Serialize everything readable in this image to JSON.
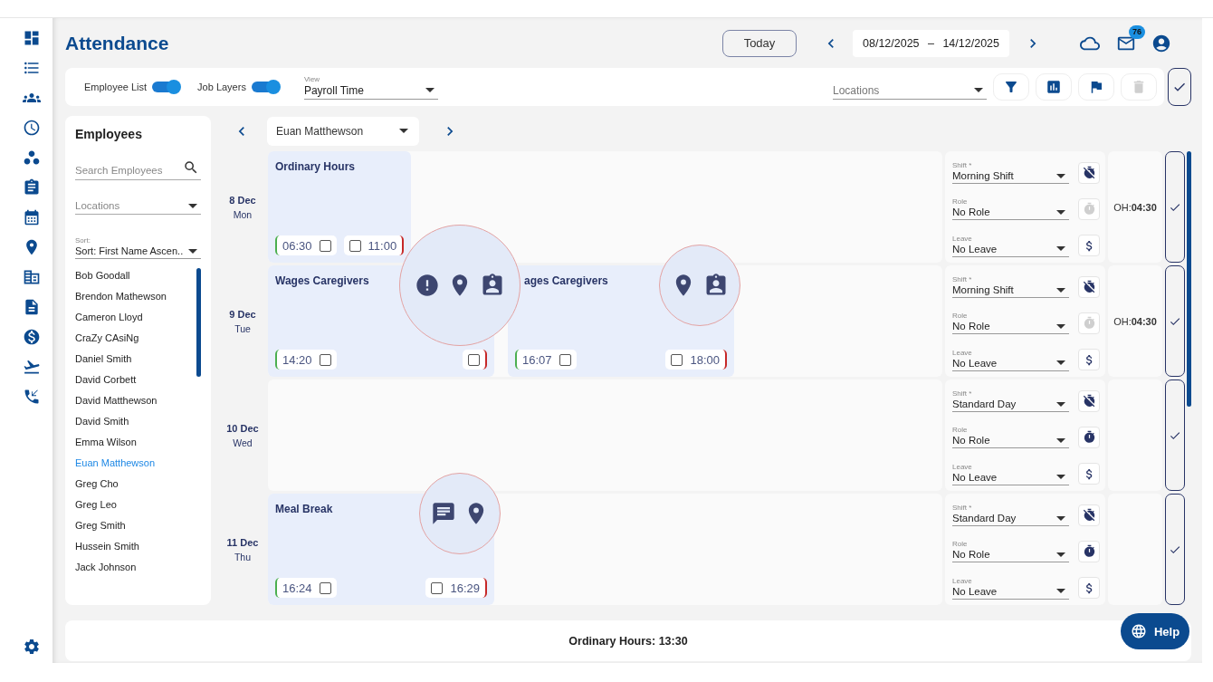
{
  "header": {
    "title": "Attendance",
    "today": "Today",
    "date_from": "08/12/2025",
    "date_sep": "–",
    "date_to": "14/12/2025",
    "mail_badge": "76"
  },
  "toolbar": {
    "toggles": [
      {
        "label": "Employee List",
        "on": true
      },
      {
        "label": "Job Layers",
        "on": true
      }
    ],
    "view": {
      "label": "View",
      "value": "Payroll Time"
    },
    "locations": {
      "placeholder": "Locations"
    },
    "actions": [
      {
        "kind": "filter",
        "disabled": false
      },
      {
        "kind": "chart",
        "disabled": false
      },
      {
        "kind": "flag",
        "disabled": false
      },
      {
        "kind": "delete",
        "disabled": true
      }
    ]
  },
  "employees": {
    "title": "Employees",
    "search": {
      "placeholder": "Search Employees"
    },
    "locations": {
      "placeholder": "Locations"
    },
    "sort": {
      "label": "Sort:",
      "value": "Sort: First Name Ascen.."
    },
    "items": [
      {
        "name": "Bob Goodall",
        "selected": false
      },
      {
        "name": "Brendon Mathewson",
        "selected": false
      },
      {
        "name": "Cameron Lloyd",
        "selected": false
      },
      {
        "name": "CraZy CAsiNg",
        "selected": false
      },
      {
        "name": "Daniel Smith",
        "selected": false
      },
      {
        "name": "David Corbett",
        "selected": false
      },
      {
        "name": "David Matthewson",
        "selected": false
      },
      {
        "name": "David Smith",
        "selected": false
      },
      {
        "name": "Emma Wilson",
        "selected": false
      },
      {
        "name": "Euan Matthewson",
        "selected": true
      },
      {
        "name": "Greg Cho",
        "selected": false
      },
      {
        "name": "Greg Leo",
        "selected": false
      },
      {
        "name": "Greg Smith",
        "selected": false
      },
      {
        "name": "Hussein Smith",
        "selected": false
      },
      {
        "name": "Jack Johnson",
        "selected": false
      }
    ]
  },
  "schedule": {
    "employee": "Euan Matthewson",
    "days": [
      {
        "date": "8 Dec",
        "weekday": "Mon",
        "blocks": [
          {
            "title": "Ordinary Hours",
            "start": {
              "time": "06:30",
              "checked": false
            },
            "end": {
              "time": "11:00",
              "checked": false
            }
          }
        ],
        "fields": [
          {
            "label": "Shift *",
            "value": "Morning Shift",
            "kind": "timer-off",
            "disabled": false
          },
          {
            "label": "Role",
            "value": "No Role",
            "kind": "timer",
            "disabled": true
          },
          {
            "label": "Leave",
            "value": "No Leave",
            "kind": "dollar",
            "disabled": false
          }
        ],
        "hours": "OH:**04:30**"
      },
      {
        "date": "9 Dec",
        "weekday": "Tue",
        "blocks": [
          {
            "title": "Wages Caregivers",
            "start": {
              "time": "14:20",
              "checked": false
            },
            "end": {
              "checked": false
            },
            "indicators": [
              {
                "kind": "alert"
              },
              {
                "kind": "location"
              },
              {
                "kind": "contact"
              }
            ]
          },
          {
            "title": "ages Caregivers",
            "start": {
              "time": "16:07",
              "checked": false
            },
            "end": {
              "time": "18:00",
              "checked": false
            },
            "indicators": [
              {
                "kind": "location"
              },
              {
                "kind": "contact"
              }
            ]
          }
        ],
        "fields": [
          {
            "label": "Shift *",
            "value": "Morning Shift",
            "kind": "timer-off",
            "disabled": false
          },
          {
            "label": "Role",
            "value": "No Role",
            "kind": "timer",
            "disabled": true
          },
          {
            "label": "Leave",
            "value": "No Leave",
            "kind": "dollar",
            "disabled": false
          }
        ],
        "hours": "OH:**04:30**"
      },
      {
        "date": "10 Dec",
        "weekday": "Wed",
        "fields": [
          {
            "label": "Shift *",
            "value": "Standard Day",
            "kind": "timer-off",
            "disabled": false
          },
          {
            "label": "Role",
            "value": "No Role",
            "kind": "timer",
            "disabled": false
          },
          {
            "label": "Leave",
            "value": "No Leave",
            "kind": "dollar",
            "disabled": false
          }
        ]
      },
      {
        "date": "11 Dec",
        "weekday": "Thu",
        "blocks": [
          {
            "title": "Meal Break",
            "start": {
              "time": "16:24",
              "checked": false
            },
            "end": {
              "time": "16:29",
              "checked": false
            },
            "indicators": [
              {
                "kind": "comment"
              },
              {
                "kind": "location"
              }
            ]
          }
        ],
        "fields": [
          {
            "label": "Shift *",
            "value": "Standard Day",
            "kind": "timer-off",
            "disabled": false
          },
          {
            "label": "Role",
            "value": "No Role",
            "kind": "timer",
            "disabled": false
          },
          {
            "label": "Leave",
            "value": "No Leave",
            "kind": "dollar",
            "disabled": false
          }
        ]
      }
    ]
  },
  "footer": {
    "summary": "Ordinary Hours: 13:30"
  },
  "help": "Help"
}
